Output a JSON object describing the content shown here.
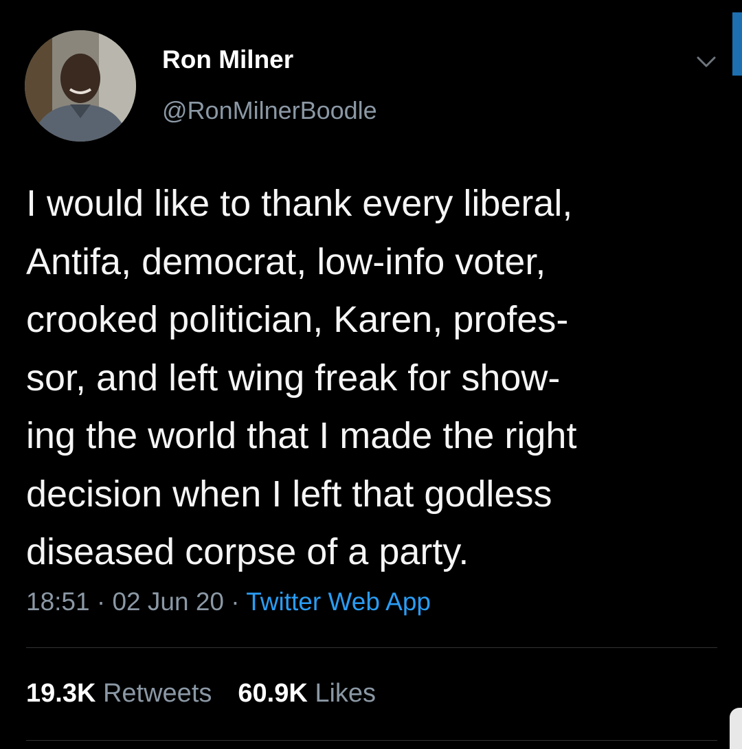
{
  "tweet": {
    "author": {
      "display_name": "Ron Milner",
      "handle": "@RonMilnerBoodle",
      "avatar_icon": "profile-photo"
    },
    "text_lines": [
      "I would like to thank every liberal,",
      "Antifa, democrat, low-info voter,",
      "crooked politician, Karen, profes-",
      "sor, and left wing freak for show-",
      "ing the world that I made the right",
      "decision when I left that godless",
      "diseased corpse of a party."
    ],
    "time": "18:51",
    "separator": "·",
    "date": "02 Jun 20",
    "source": "Twitter Web App",
    "retweets_count": "19.3K",
    "retweets_label": "Retweets",
    "likes_count": "60.9K",
    "likes_label": "Likes"
  },
  "colors": {
    "background": "#000000",
    "text": "#f5f5f5",
    "secondary": "#8b98a5",
    "link": "#2a9df4"
  },
  "icons": {
    "menu": "chevron-down-icon"
  }
}
